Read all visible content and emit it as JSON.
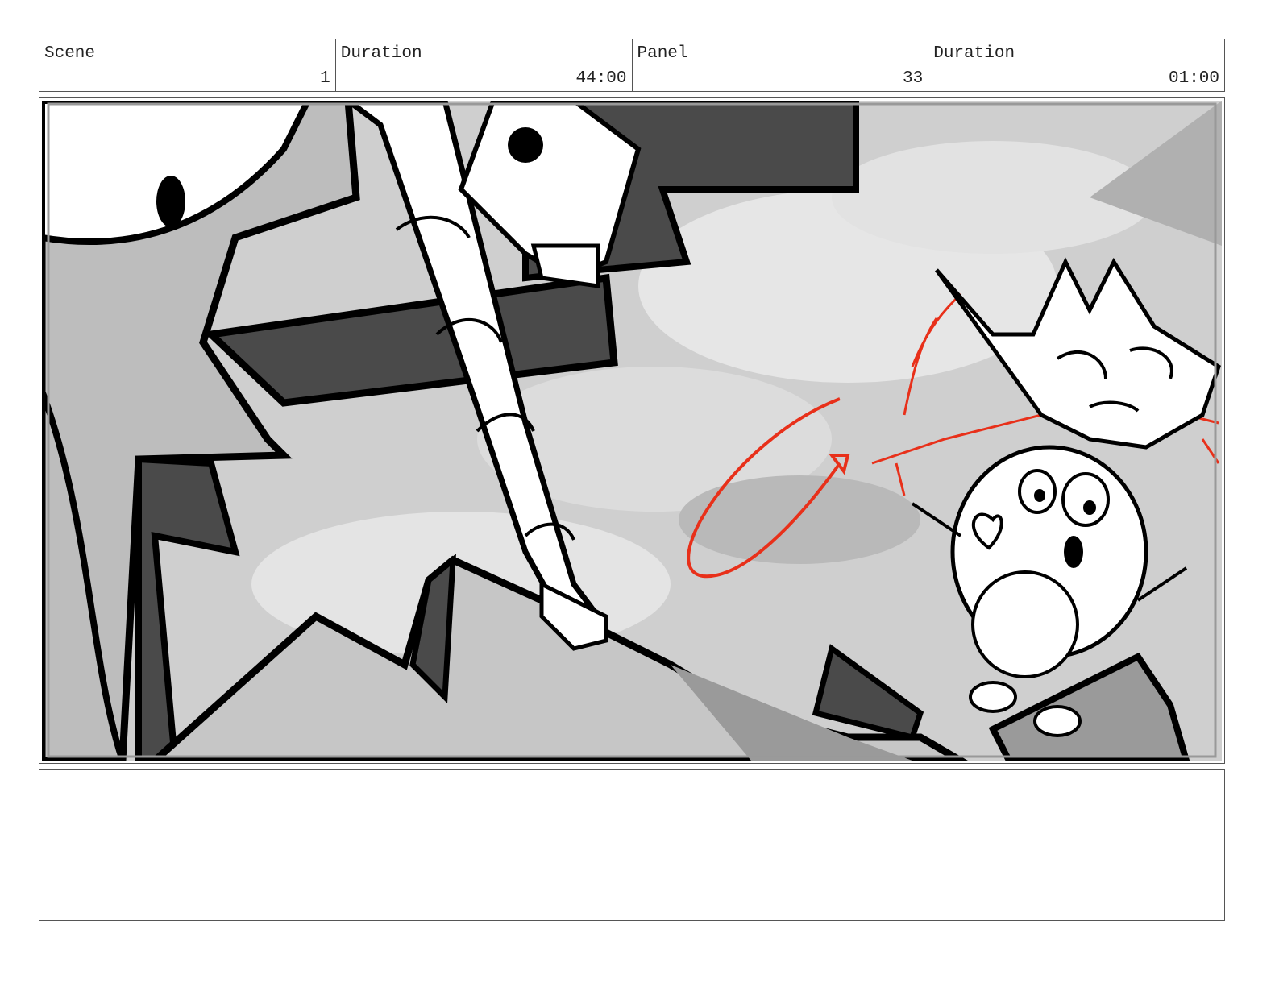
{
  "header": {
    "scene_label": "Scene",
    "scene_value": "1",
    "scene_duration_label": "Duration",
    "scene_duration_value": "44:00",
    "panel_label": "Panel",
    "panel_value": "33",
    "panel_duration_label": "Duration",
    "panel_duration_value": "01:00"
  },
  "notes": {
    "text": ""
  },
  "colors": {
    "ink": "#000000",
    "annotation": "#e8301a",
    "dark_fill": "#4a4a4a",
    "mid_fill": "#9a9a9a",
    "sky": "#cfcfcf"
  }
}
